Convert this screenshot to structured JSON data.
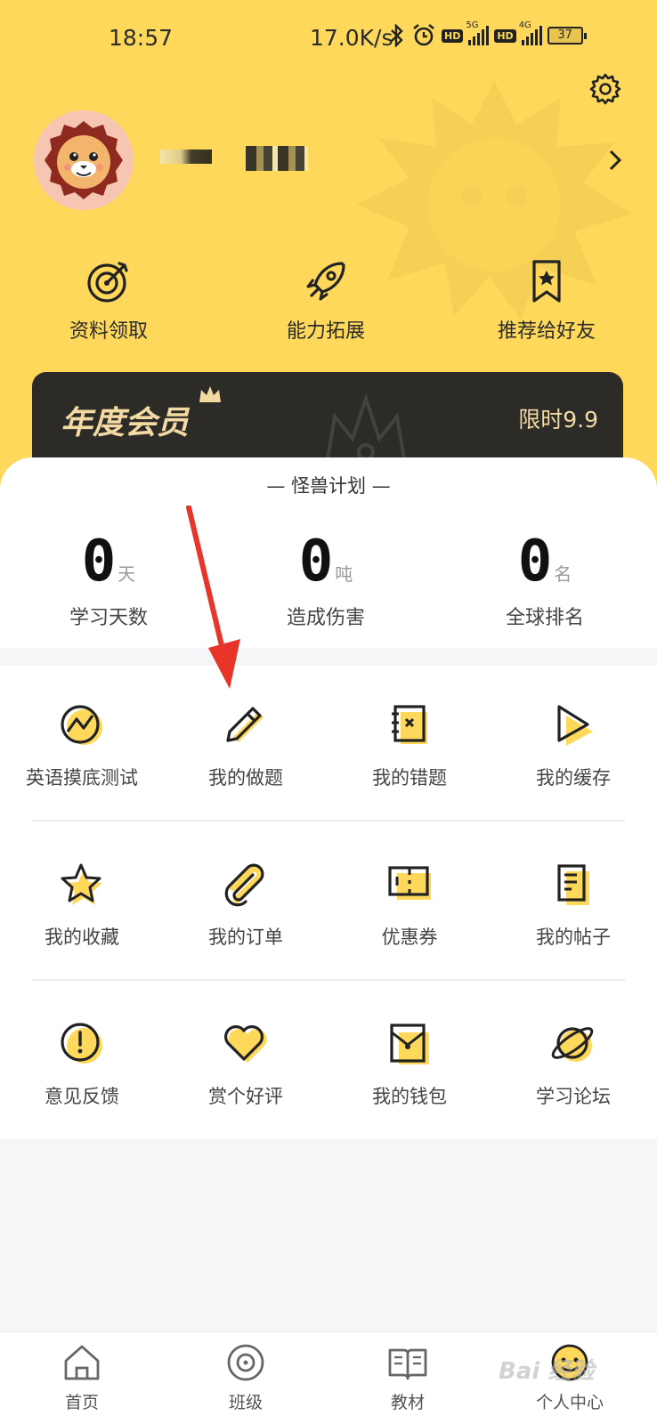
{
  "status_bar": {
    "time": "18:57",
    "speed": "17.0K/s",
    "hd1": "HD",
    "net1": "5G",
    "hd2": "HD",
    "net2": "4G",
    "battery": "37"
  },
  "quick_actions": [
    {
      "label": "资料领取",
      "icon": "target-icon"
    },
    {
      "label": "能力拓展",
      "icon": "rocket-icon"
    },
    {
      "label": "推荐给好友",
      "icon": "bookmark-star-icon"
    }
  ],
  "vip": {
    "title": "年度会员",
    "price": "限时9.9"
  },
  "plan": {
    "title": "— 怪兽计划 —",
    "stats": [
      {
        "value": "0",
        "unit": "天",
        "label": "学习天数"
      },
      {
        "value": "0",
        "unit": "吨",
        "label": "造成伤害"
      },
      {
        "value": "0",
        "unit": "名",
        "label": "全球排名"
      }
    ]
  },
  "menu": [
    {
      "label": "英语摸底测试",
      "icon": "trend-chart-icon"
    },
    {
      "label": "我的做题",
      "icon": "pencil-icon"
    },
    {
      "label": "我的错题",
      "icon": "error-notebook-icon"
    },
    {
      "label": "我的缓存",
      "icon": "play-icon"
    },
    {
      "label": "我的收藏",
      "icon": "star-icon"
    },
    {
      "label": "我的订单",
      "icon": "paperclip-icon"
    },
    {
      "label": "优惠券",
      "icon": "ticket-icon"
    },
    {
      "label": "我的帖子",
      "icon": "document-icon"
    },
    {
      "label": "意见反馈",
      "icon": "alert-circle-icon"
    },
    {
      "label": "赏个好评",
      "icon": "heart-icon"
    },
    {
      "label": "我的钱包",
      "icon": "wallet-icon"
    },
    {
      "label": "学习论坛",
      "icon": "planet-icon"
    }
  ],
  "tabs": [
    {
      "label": "首页",
      "icon": "home-icon"
    },
    {
      "label": "班级",
      "icon": "class-disc-icon"
    },
    {
      "label": "教材",
      "icon": "book-icon"
    },
    {
      "label": "个人中心",
      "icon": "smiley-icon"
    }
  ],
  "watermark": "Bai 经验",
  "colors": {
    "brand_yellow": "#fdd85a",
    "vip_dark": "#2c2b28",
    "vip_gold": "#f3d9a2",
    "arrow_red": "#e8352a"
  }
}
